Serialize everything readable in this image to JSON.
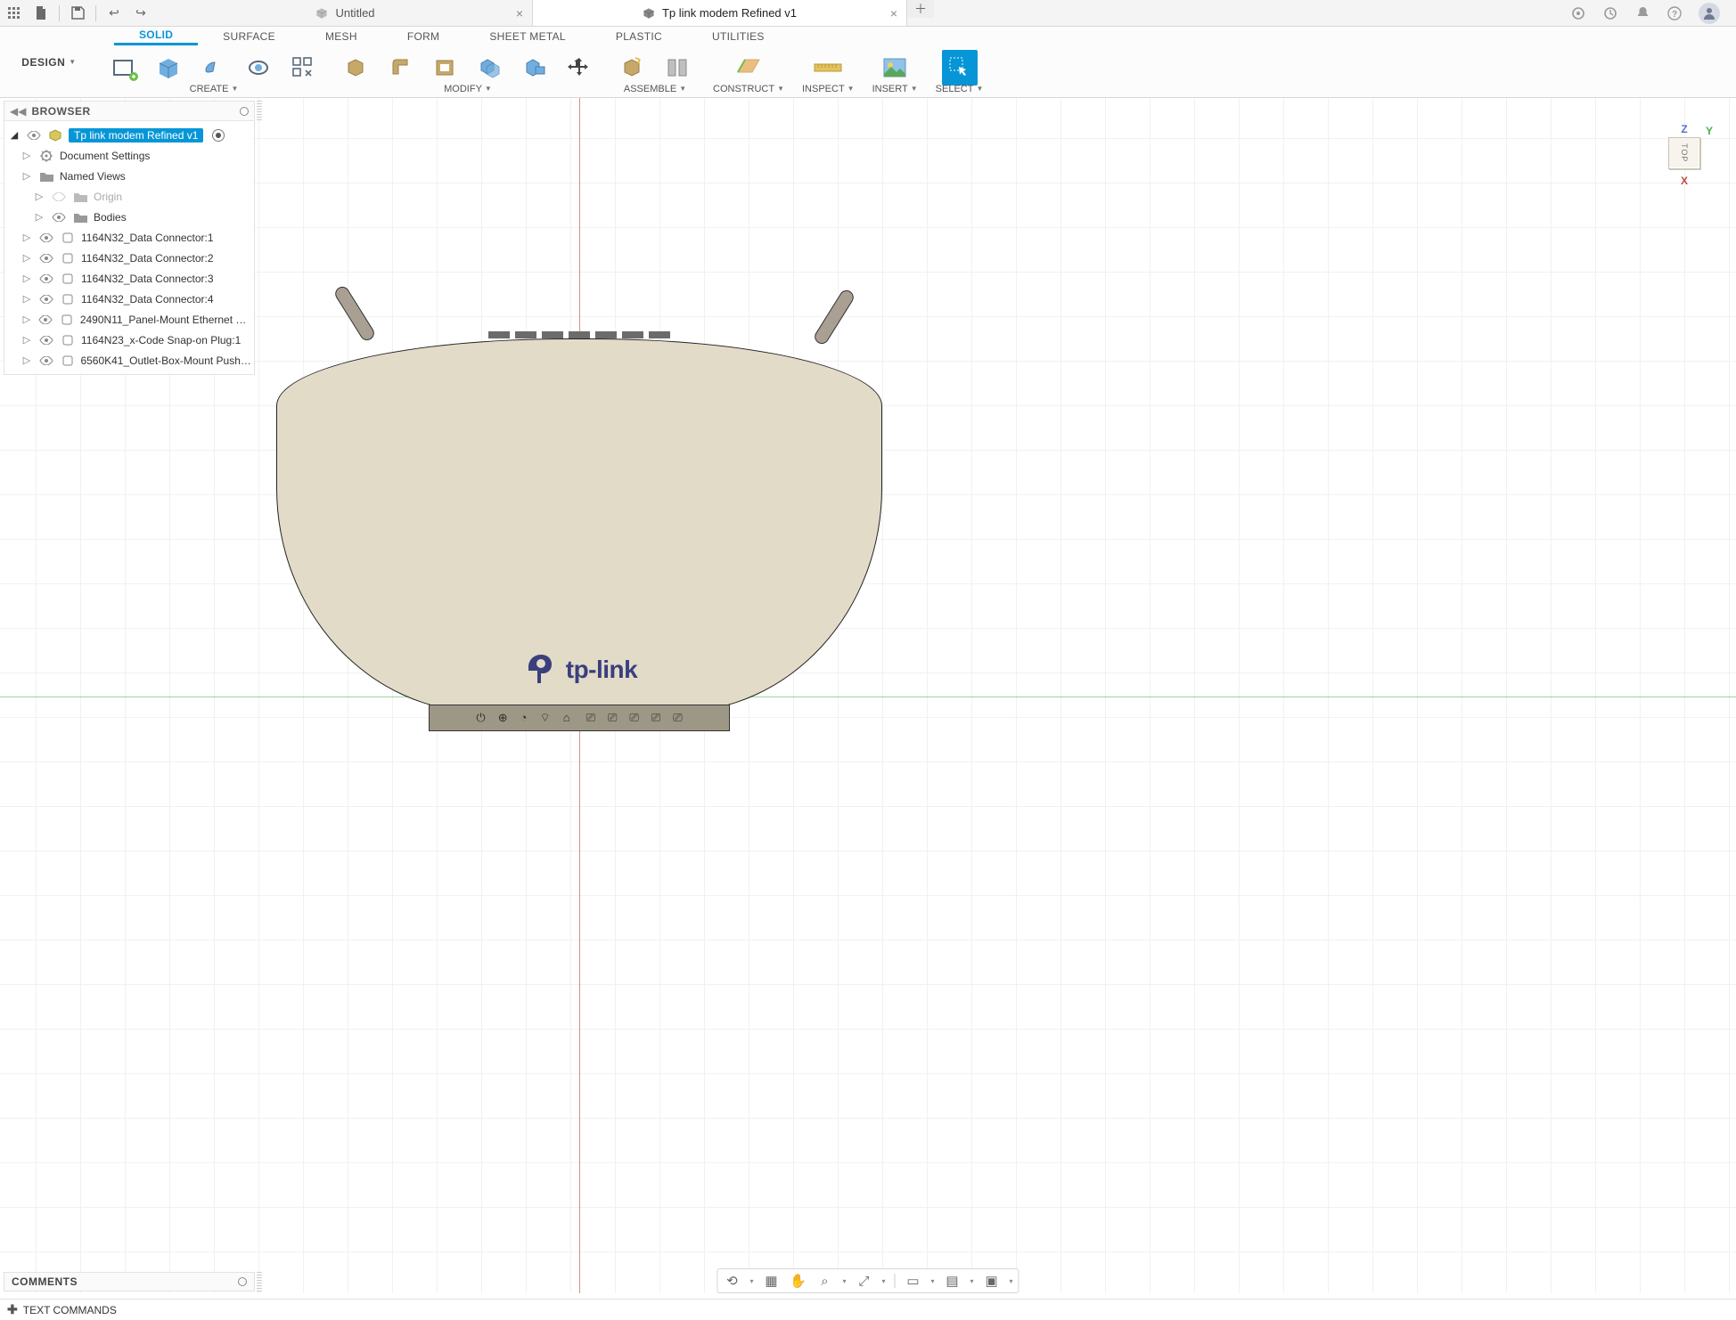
{
  "app": {
    "qat": {
      "grid": "grid",
      "file": "file",
      "save": "save",
      "undo": "undo",
      "redo": "redo"
    },
    "tabs": [
      {
        "title": "Untitled",
        "active": false
      },
      {
        "title": "Tp link modem Refined v1",
        "active": true
      }
    ],
    "top_icons": {
      "add": "+",
      "ext": "ext",
      "job": "job",
      "notif": "notif",
      "help": "?",
      "user": "user"
    }
  },
  "ribbon": {
    "design_label": "DESIGN",
    "tabs": [
      "SOLID",
      "SURFACE",
      "MESH",
      "FORM",
      "SHEET METAL",
      "PLASTIC",
      "UTILITIES"
    ],
    "active_tab": "SOLID",
    "groups": {
      "create": "CREATE",
      "modify": "MODIFY",
      "assemble": "ASSEMBLE",
      "construct": "CONSTRUCT",
      "inspect": "INSPECT",
      "insert": "INSERT",
      "select": "SELECT"
    }
  },
  "browser": {
    "title": "BROWSER",
    "root": "Tp link modem Refined v1",
    "items": [
      {
        "label": "Document Settings",
        "icon": "gear"
      },
      {
        "label": "Named Views",
        "icon": "folder"
      },
      {
        "label": "Origin",
        "icon": "folder",
        "dim": true,
        "indent": true
      },
      {
        "label": "Bodies",
        "icon": "folder",
        "indent": true
      },
      {
        "label": "1164N32_Data Connector:1",
        "icon": "comp"
      },
      {
        "label": "1164N32_Data Connector:2",
        "icon": "comp"
      },
      {
        "label": "1164N32_Data Connector:3",
        "icon": "comp"
      },
      {
        "label": "1164N32_Data Connector:4",
        "icon": "comp"
      },
      {
        "label": "2490N11_Panel-Mount Ethernet Co...",
        "icon": "comp"
      },
      {
        "label": "1164N23_x-Code Snap-on Plug:1",
        "icon": "comp"
      },
      {
        "label": "6560K41_Outlet-Box-Mount Push-t...",
        "icon": "comp"
      }
    ]
  },
  "viewcube": {
    "face": "TOP",
    "axes": {
      "z": "Z",
      "y": "Y",
      "x": "X"
    }
  },
  "model": {
    "brand": "tp-link"
  },
  "panels": {
    "comments": "COMMENTS",
    "text_commands": "TEXT COMMANDS"
  },
  "navbar": [
    "orbit",
    "camera",
    "pan",
    "zoom",
    "fit",
    "display",
    "grid",
    "layout"
  ]
}
